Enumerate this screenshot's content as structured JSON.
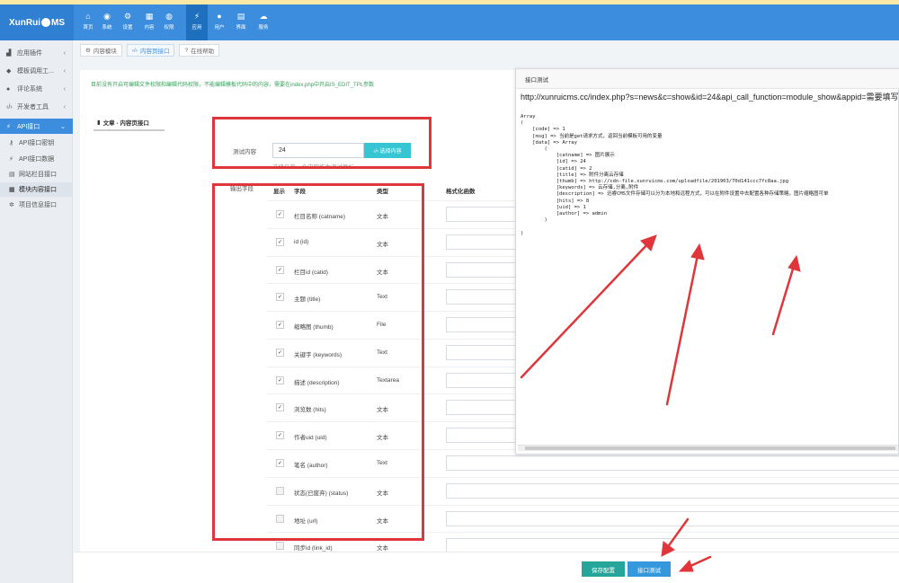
{
  "app": {
    "logo_text_1": "XunRui",
    "logo_text_2": "MS"
  },
  "topnav": [
    {
      "icon": "home-icon",
      "glyph": "⌂",
      "label": "首页"
    },
    {
      "icon": "globe-icon",
      "glyph": "◉",
      "label": "系统"
    },
    {
      "icon": "cogs-icon",
      "glyph": "⚙",
      "label": "设置"
    },
    {
      "icon": "grid-icon",
      "glyph": "▦",
      "label": "内容"
    },
    {
      "icon": "user-circle-icon",
      "glyph": "◍",
      "label": "权限"
    },
    {
      "icon": "plug-icon",
      "glyph": "⚡",
      "label": "应用"
    },
    {
      "icon": "user-icon",
      "glyph": "●",
      "label": "用户"
    },
    {
      "icon": "layout-icon",
      "glyph": "▤",
      "label": "界面"
    },
    {
      "icon": "cloud-icon",
      "glyph": "☁",
      "label": "服务"
    }
  ],
  "sidebar": {
    "items": [
      {
        "icon": "plugin-icon",
        "glyph": "▟",
        "label": "应用插件"
      },
      {
        "icon": "tag-icon",
        "glyph": "◆",
        "label": "模板调用工..."
      },
      {
        "icon": "comments-icon",
        "glyph": "●",
        "label": "评论系统"
      },
      {
        "icon": "code-icon",
        "glyph": "‹/›",
        "label": "开发者工具"
      },
      {
        "icon": "plug-icon",
        "glyph": "⚡",
        "label": "API接口"
      }
    ],
    "subitems": [
      {
        "icon": "key-icon",
        "glyph": "⚷",
        "label": "API接口密钥"
      },
      {
        "icon": "plug-icon",
        "glyph": "⚡",
        "label": "API接口数据"
      },
      {
        "icon": "table-icon",
        "glyph": "▤",
        "label": "网站栏目接口"
      },
      {
        "icon": "th-icon",
        "glyph": "▦",
        "label": "模块内容接口"
      },
      {
        "icon": "gear-icon",
        "glyph": "✲",
        "label": "项目信息接口"
      }
    ]
  },
  "tabs": [
    {
      "icon": "cogs-icon",
      "glyph": "⚙",
      "label": "内容模块"
    },
    {
      "icon": "code-icon",
      "glyph": "‹/›",
      "label": "内容页接口"
    },
    {
      "icon": "question-icon",
      "glyph": "?",
      "label": "在线帮助"
    }
  ],
  "notice": "目前没有开启可编辑文件权限和编辑代码权限，不能编辑模板代码中的内容，需要在index.php中开启IS_EDIT_TPL参数",
  "subtab": {
    "icon": "doc-icon",
    "glyph": "▮",
    "label": "文章 - 内容页接口"
  },
  "form": {
    "test_label": "测试内容",
    "test_value": "24",
    "select_button": "‹/› 选择内容",
    "help_text": "选择任意一个内容作为测试目标",
    "fields_label": "输出字段"
  },
  "table": {
    "headers": {
      "show": "显示",
      "field": "字段",
      "type": "类型",
      "format": "格式化函数"
    },
    "rows": [
      {
        "name": "栏目名称 (catname)",
        "type": "文本",
        "checked": "✓"
      },
      {
        "name": "id (id)",
        "type": "文本",
        "checked": "✓"
      },
      {
        "name": "栏目id (catid)",
        "type": "文本",
        "checked": "✓"
      },
      {
        "name": "主题 (title)",
        "type": "Text",
        "checked": "✓"
      },
      {
        "name": "缩略图 (thumb)",
        "type": "File",
        "checked": "✓"
      },
      {
        "name": "关键字 (keywords)",
        "type": "Text",
        "checked": "✓"
      },
      {
        "name": "描述 (description)",
        "type": "Textarea",
        "checked": "✓"
      },
      {
        "name": "浏览数 (hits)",
        "type": "文本",
        "checked": "✓"
      },
      {
        "name": "作者uid (uid)",
        "type": "文本",
        "checked": "✓"
      },
      {
        "name": "笔名 (author)",
        "type": "Text",
        "checked": "✓"
      },
      {
        "name": "状态(已废弃) (status)",
        "type": "文本",
        "checked": ""
      },
      {
        "name": "地址 (url)",
        "type": "文本",
        "checked": ""
      },
      {
        "name": "同步id (link_id)",
        "type": "文本",
        "checked": ""
      }
    ]
  },
  "api_panel": {
    "title": "接口测试",
    "url": "http://xunruicms.cc/index.php?s=news&c=show&id=24&api_call_function=module_show&appid=需要填写",
    "response": "Array\n(\n    [code] => 1\n    [msg] => 当前是get请求方式，返回当前模板可用的变量\n    [data] => Array\n        (\n            [catname] => 图片展示\n            [id] => 24\n            [catid] => 2\n            [title] => 附件分离云存储\n            [thumb] => http://cdn-file.xunruicms.com/uploadfile/201903/70d141ccc7fc8aa.jpg\n            [keywords] => 云存储,分离,附件\n            [description] => 迅睿CMS文件存储可以分为本地和远程方式，可以在附件设置中去配置各种存储策略，图片缩略图可单\n            [hits] => 8\n            [uid] => 1\n            [author] => admin\n        )\n\n)"
  },
  "footer": {
    "save": "保存配置",
    "test": "接口测试"
  },
  "colors": {
    "topbar": "#3c8dde",
    "highlight": "#e0363b",
    "save_btn": "#26a69a",
    "test_btn": "#3598dc",
    "select_btn": "#36c6d3"
  }
}
